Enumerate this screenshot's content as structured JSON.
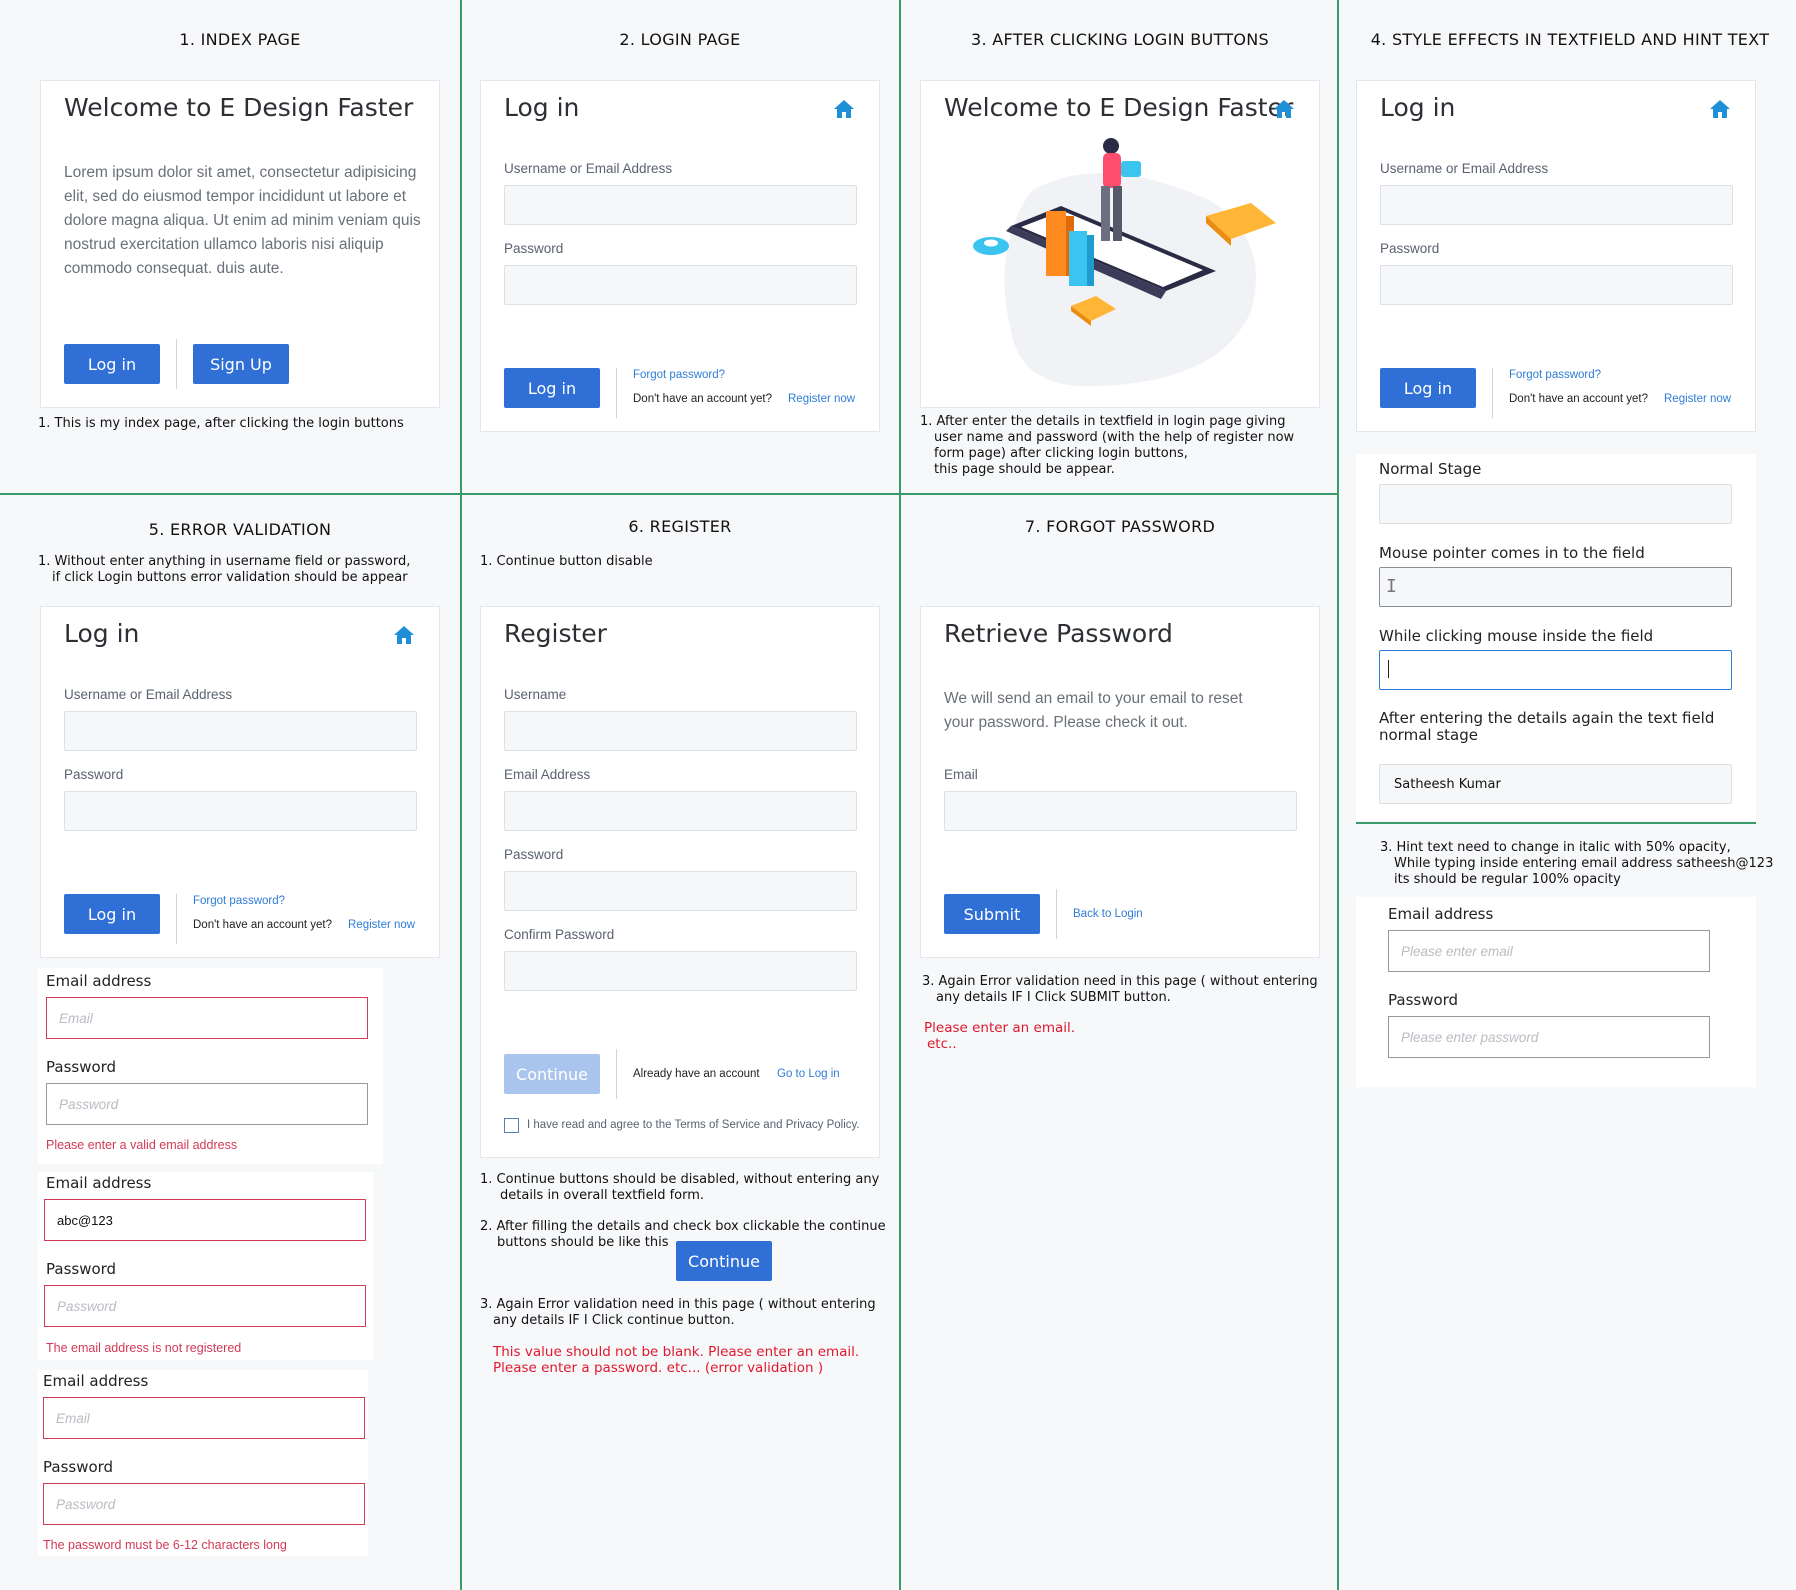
{
  "sections": {
    "s1": "1. INDEX PAGE",
    "s2": "2. LOGIN PAGE",
    "s3": "3. AFTER CLICKING LOGIN BUTTONS",
    "s4": "4. STYLE EFFECTS IN TEXTFIELD AND HINT TEXT",
    "s5": "5. ERROR VALIDATION",
    "s6": "6. REGISTER",
    "s7": "7. FORGOT PASSWORD"
  },
  "index": {
    "title": "Welcome to E Design Faster",
    "body": "Lorem ipsum dolor sit amet, consectetur adipisicing elit, sed do eiusmod tempor incididunt ut labore et dolore magna aliqua. Ut enim ad minim veniam quis nostrud exercitation ullamco laboris nisi aliquip commodo consequat. duis aute.",
    "login_label": "Log in",
    "signup_label": "Sign Up",
    "note": "1. This is my index page, after clicking the login buttons"
  },
  "login": {
    "title": "Log in",
    "username_label": "Username or Email Address",
    "password_label": "Password",
    "login_label": "Log in",
    "forgot": "Forgot password?",
    "no_account": "Don't have an account yet?",
    "register": "Register now"
  },
  "welcome": {
    "title": "Welcome to E Design Faster",
    "note_1": "1. After enter the details in textfield in login page giving",
    "note_2": "user name and password (with the help of register now",
    "note_3": "form page) after clicking login buttons,",
    "note_4": "this page should be appear."
  },
  "style": {
    "normal": "Normal Stage",
    "hover": "Mouse pointer comes in to the field",
    "click": "While clicking mouse inside the field",
    "after": "After entering the details again the text field normal stage",
    "value": "Satheesh Kumar",
    "note_1": "3. Hint text need to change in italic with 50% opacity,",
    "note_2": "While typing inside entering email address satheesh@123",
    "note_3": "its should be regular 100% opacity",
    "email_label": "Email address",
    "email_ph": "Please enter email",
    "password_label": "Password",
    "password_ph": "Please enter password"
  },
  "errors": {
    "note_1": "1. Without enter anything in username field or password,",
    "note_2": "if click Login buttons error validation should be appear",
    "email_label": "Email address",
    "password_label": "Password",
    "email_ph": "Email",
    "password_ph": "Password",
    "email_value": "abc@123",
    "err1": "Please enter a valid email address",
    "err2": "The email address is not registered",
    "err3": "The password must be 6-12 characters long"
  },
  "register": {
    "note": "1. Continue button disable",
    "title": "Register",
    "username": "Username",
    "email": "Email Address",
    "password": "Password",
    "confirm": "Confirm Password",
    "continue": "Continue",
    "have_account": "Already have an account",
    "go_login": "Go to Log in",
    "terms": "I have read and agree to the Terms of Service and Privacy Policy.",
    "n1a": "1. Continue buttons should be disabled, without entering any",
    "n1b": "details in overall textfield form.",
    "n2a": "2. After filling the details and check box clickable the continue",
    "n2b": "buttons should be like this",
    "n3a": "3. Again  Error validation need in this page ( without entering",
    "n3b": "any details IF I Click continue button.",
    "e1": "This value should not be blank. Please enter an email.",
    "e2": "Please enter a password. etc... (error validation )"
  },
  "forgot": {
    "title": "Retrieve Password",
    "body": "We will send an email to your email to reset your password. Please check it out.",
    "email_label": "Email",
    "submit": "Submit",
    "back": "Back to Login",
    "n1": "3. Again  Error validation need in this page ( without entering",
    "n2": "any details IF I Click SUBMIT button.",
    "e1": "Please enter an email.",
    "e2": "etc.."
  },
  "colors": {
    "primary": "#2f6fd6",
    "disabled": "#a9c5ee",
    "error": "#d23a55",
    "divider": "#3a9a6a",
    "home_icon": "#1f8fd8"
  }
}
